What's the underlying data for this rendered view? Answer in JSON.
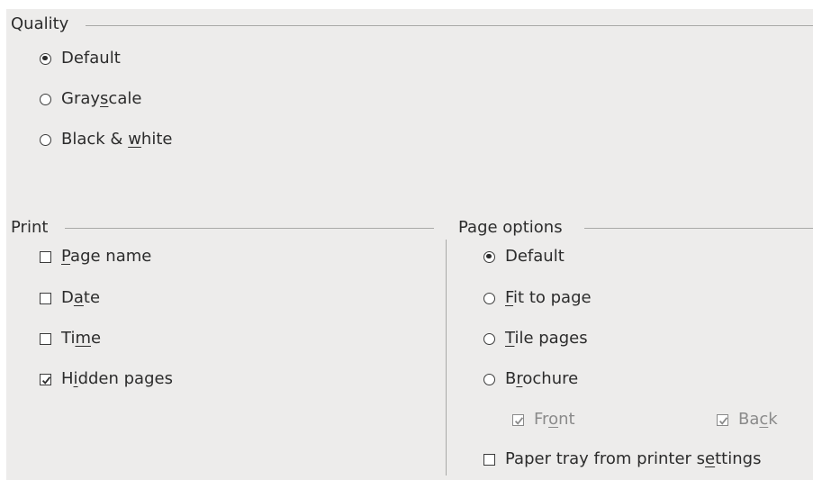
{
  "quality": {
    "title": "Quality",
    "options": [
      {
        "pre": "Default",
        "mn": "",
        "post": "",
        "checked": true
      },
      {
        "pre": "Gray",
        "mn": "s",
        "post": "cale",
        "checked": false
      },
      {
        "pre": "Black & ",
        "mn": "w",
        "post": "hite",
        "checked": false
      }
    ]
  },
  "print": {
    "title": "Print",
    "options": [
      {
        "pre": "",
        "mn": "P",
        "post": "age name",
        "checked": false
      },
      {
        "pre": "D",
        "mn": "a",
        "post": "te",
        "checked": false
      },
      {
        "pre": "Ti",
        "mn": "m",
        "post": "e",
        "checked": false
      },
      {
        "pre": "H",
        "mn": "i",
        "post": "dden pages",
        "checked": true
      }
    ]
  },
  "page_options": {
    "title": "Page options",
    "options": [
      {
        "pre": "Default",
        "mn": "",
        "post": "",
        "checked": true
      },
      {
        "pre": "",
        "mn": "F",
        "post": "it to page",
        "checked": false
      },
      {
        "pre": "",
        "mn": "T",
        "post": "ile pages",
        "checked": false
      },
      {
        "pre": "B",
        "mn": "r",
        "post": "ochure",
        "checked": false
      }
    ],
    "front": {
      "pre": "Fr",
      "mn": "o",
      "post": "nt",
      "checked": true
    },
    "back": {
      "pre": "Ba",
      "mn": "c",
      "post": "k",
      "checked": true
    },
    "paper_tray": {
      "pre": "Paper tray from printer s",
      "mn": "e",
      "post": "ttings",
      "checked": false
    }
  }
}
